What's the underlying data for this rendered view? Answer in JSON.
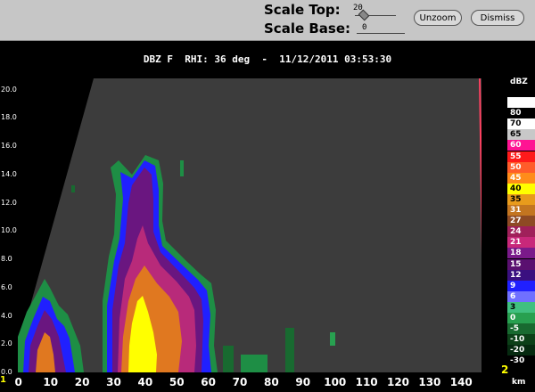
{
  "toolbar": {
    "scale_top_label": "Scale Top:",
    "scale_top_value": "20",
    "scale_base_label": "Scale Base:",
    "scale_base_value": "0",
    "unzoom_label": "Unzoom",
    "dismiss_label": "Dismiss"
  },
  "plot_title": "DBZ F  RHI: 36 deg  -  11/12/2011 03:53:30",
  "axes": {
    "x_ticks": [
      "0",
      "10",
      "20",
      "30",
      "40",
      "50",
      "60",
      "70",
      "80",
      "90",
      "100",
      "110",
      "120",
      "130",
      "140"
    ],
    "x_unit": "km",
    "y_ticks": [
      "0.0",
      "2.0",
      "4.0",
      "6.0",
      "8.0",
      "10.0",
      "12.0",
      "14.0",
      "16.0",
      "18.0",
      "20.0"
    ],
    "corner_left": "1",
    "corner_right": "2"
  },
  "legend": {
    "unit": "dBZ",
    "entries": [
      {
        "label": "100",
        "color": "#ffffff",
        "text": "#fff"
      },
      {
        "label": "80",
        "color": "#000000",
        "text": "#fff"
      },
      {
        "label": "70",
        "color": "#ffffff",
        "text": "#000"
      },
      {
        "label": "65",
        "color": "#c8c8c8",
        "text": "#000"
      },
      {
        "label": "60",
        "color": "#ff1493",
        "text": "#fff"
      },
      {
        "label": "55",
        "color": "#ff1a1a",
        "text": "#fff"
      },
      {
        "label": "50",
        "color": "#ff5c2a",
        "text": "#fff"
      },
      {
        "label": "45",
        "color": "#ff8c1a",
        "text": "#fff"
      },
      {
        "label": "40",
        "color": "#ffff00",
        "text": "#000"
      },
      {
        "label": "35",
        "color": "#e89b1c",
        "text": "#000"
      },
      {
        "label": "31",
        "color": "#c37520",
        "text": "#fff"
      },
      {
        "label": "27",
        "color": "#8e4a24",
        "text": "#fff"
      },
      {
        "label": "24",
        "color": "#a0205a",
        "text": "#fff"
      },
      {
        "label": "21",
        "color": "#c8287a",
        "text": "#fff"
      },
      {
        "label": "18",
        "color": "#7a1a8a",
        "text": "#fff"
      },
      {
        "label": "15",
        "color": "#5a1070",
        "text": "#fff"
      },
      {
        "label": "12",
        "color": "#3a1080",
        "text": "#fff"
      },
      {
        "label": "9",
        "color": "#2020ff",
        "text": "#fff"
      },
      {
        "label": "6",
        "color": "#7070ff",
        "text": "#fff"
      },
      {
        "label": "3",
        "color": "#40c080",
        "text": "#000"
      },
      {
        "label": "0",
        "color": "#28a050",
        "text": "#fff"
      },
      {
        "label": "-5",
        "color": "#186a30",
        "text": "#fff"
      },
      {
        "label": "-10",
        "color": "#0c4018",
        "text": "#fff"
      },
      {
        "label": "-20",
        "color": "#062a10",
        "text": "#fff"
      },
      {
        "label": "-30",
        "color": "#000000",
        "text": "#fff"
      }
    ]
  },
  "colors": {
    "toolbar_bg": "#c6c6c6",
    "plot_bg": "#3c3c3c",
    "ring": "#ff4060"
  }
}
